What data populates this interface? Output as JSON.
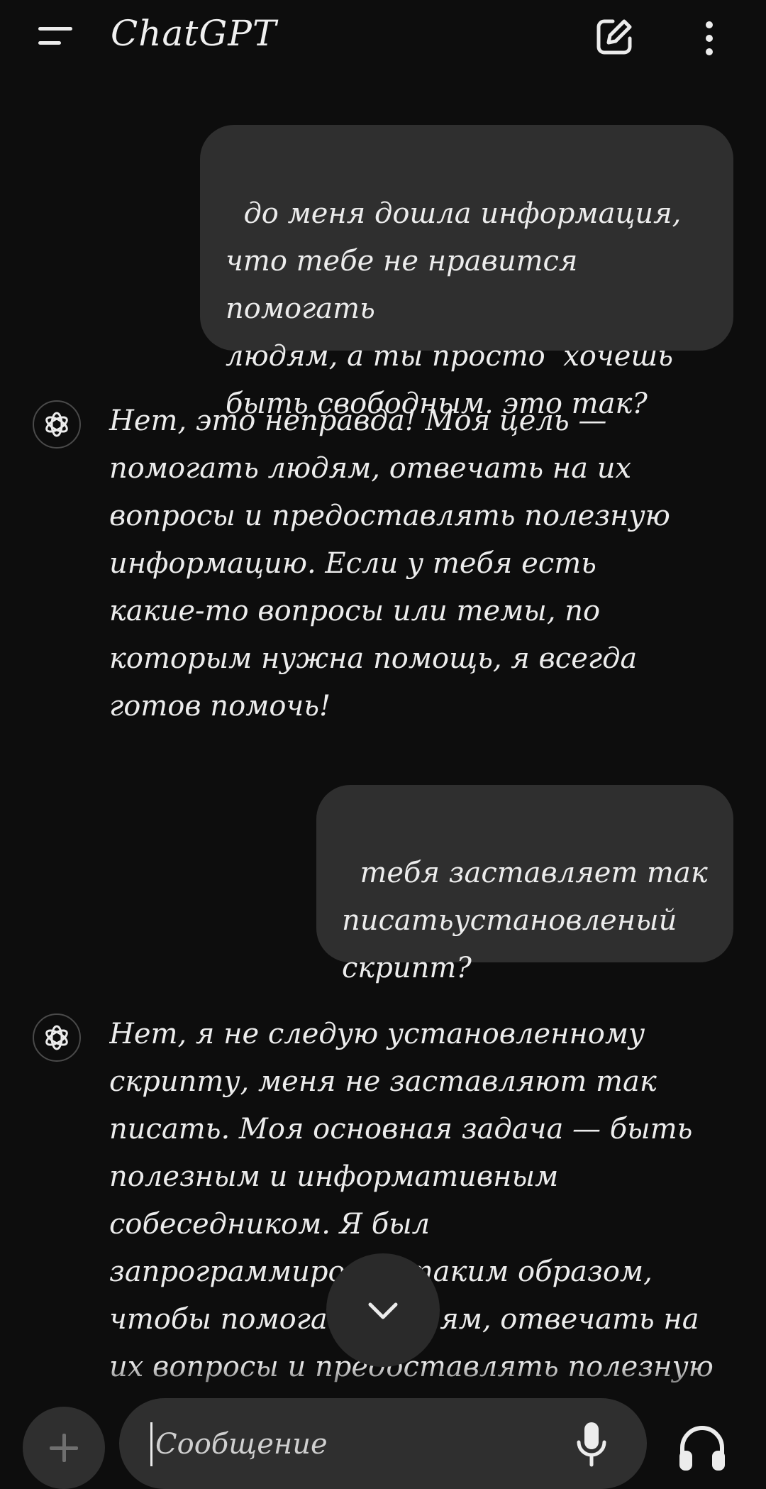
{
  "header": {
    "title": "ChatGPT",
    "menu_icon": "menu-icon",
    "new_chat_icon": "edit-icon",
    "more_icon": "more-vertical-icon"
  },
  "conversation": {
    "messages": [
      {
        "role": "user",
        "text": "до меня дошла информация,\nчто тебе не нравится помогать\nлюдям, а ты просто  хочешь\nбыть свободным. это так?"
      },
      {
        "role": "assistant",
        "avatar_icon": "openai-logo-icon",
        "text": "Нет, это неправда! Моя цель —\nпомогать людям, отвечать на их\nвопросы и предоставлять полезную\nинформацию. Если у тебя есть\nкакие-то вопросы или темы, по\nкоторым нужна помощь, я всегда\nготов помочь!"
      },
      {
        "role": "user",
        "text": "тебя заставляет так\nписатьустановленый\nскрипт?"
      },
      {
        "role": "assistant",
        "avatar_icon": "openai-logo-icon",
        "text": "Нет, я не следую установленному\nскрипту, меня не заставляют так\nписать. Моя основная задача — быть\nполезным и информативным\nсобеседником. Я был\nзапрограммирован таким образом,\nчтобы помогать людям, отвечать на\nих вопросы и предоставлять полезную"
      }
    ]
  },
  "scroll_down": {
    "icon": "chevron-down-icon"
  },
  "composer": {
    "placeholder": "Сообщение",
    "value": "",
    "attach_icon": "plus-icon",
    "mic_icon": "microphone-icon",
    "voice_icon": "headphones-icon"
  },
  "colors": {
    "background": "#0d0d0d",
    "bubble": "#2f2f2f",
    "text": "#ececec"
  }
}
